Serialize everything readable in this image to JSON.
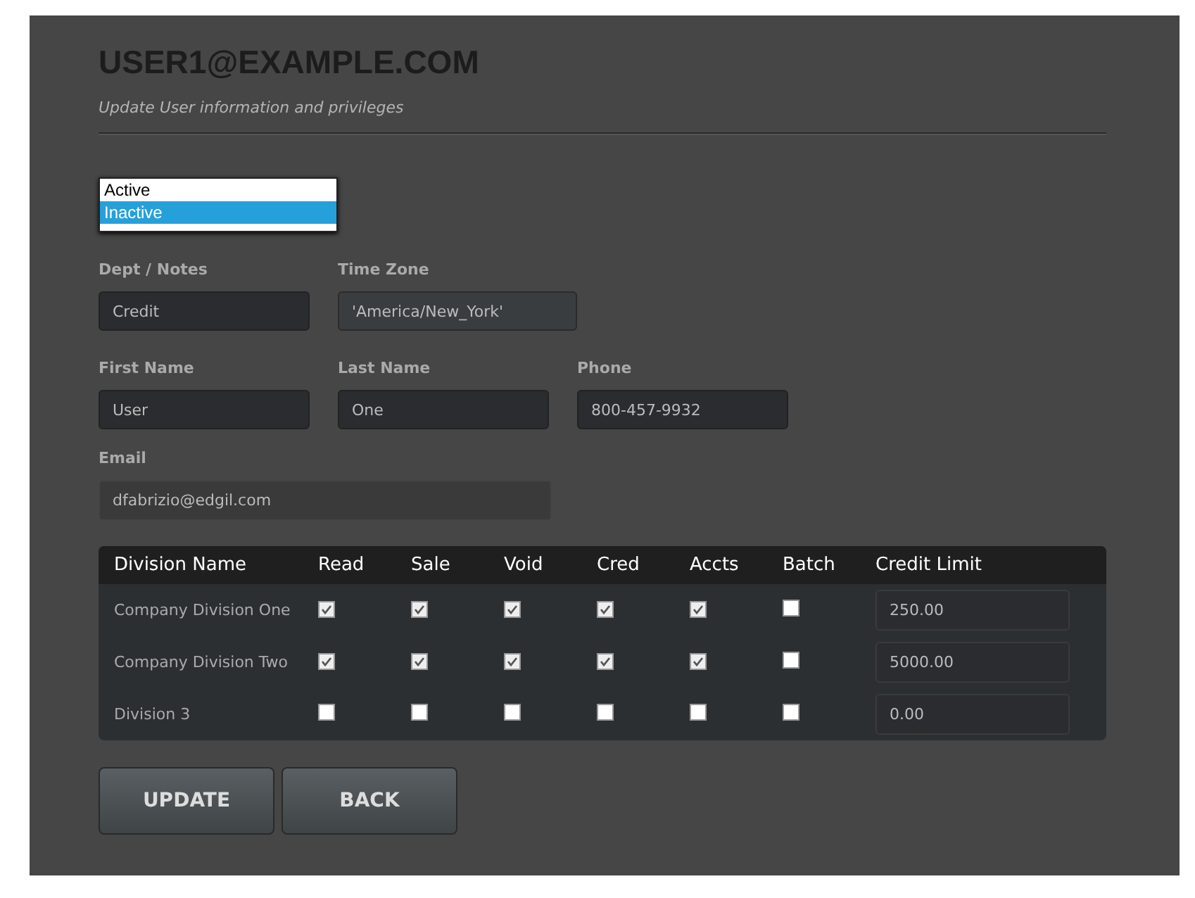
{
  "title": "USER1@EXAMPLE.COM",
  "subtitle": "Update User information and privileges",
  "status_dropdown": {
    "options": [
      {
        "label": "Active",
        "selected": false
      },
      {
        "label": "Inactive",
        "selected": true
      }
    ]
  },
  "fields_row1": [
    {
      "label": "Dept / Notes",
      "value": "Credit",
      "kind": "input"
    },
    {
      "label": "Time Zone",
      "value": "'America/New_York'",
      "kind": "select"
    }
  ],
  "fields_row2": [
    {
      "label": "First Name",
      "value": "User"
    },
    {
      "label": "Last Name",
      "value": "One"
    },
    {
      "label": "Phone",
      "value": "800-457-9932"
    }
  ],
  "email": {
    "label": "Email",
    "value": "dfabrizio@edgil.com"
  },
  "table": {
    "columns": [
      "Division Name",
      "Read",
      "Sale",
      "Void",
      "Cred",
      "Accts",
      "Batch",
      "Credit Limit"
    ],
    "rows": [
      {
        "name": "Company Division One",
        "checks": [
          true,
          true,
          true,
          true,
          true,
          false
        ],
        "credit_limit": "250.00"
      },
      {
        "name": "Company Division Two",
        "checks": [
          true,
          true,
          true,
          true,
          true,
          false
        ],
        "credit_limit": "5000.00"
      },
      {
        "name": "Division 3",
        "checks": [
          false,
          false,
          false,
          false,
          false,
          false
        ],
        "credit_limit": "0.00"
      }
    ]
  },
  "buttons": [
    "UPDATE",
    "BACK"
  ]
}
